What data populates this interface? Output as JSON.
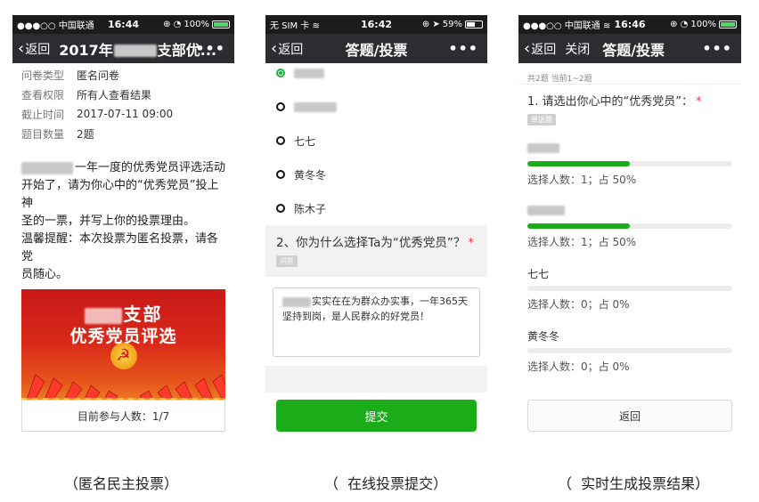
{
  "panel1": {
    "status": {
      "carrier": "●●●○○ 中国联通",
      "time": "16:44",
      "battery": "100%",
      "battery_level": 1.0
    },
    "nav": {
      "back": "返回",
      "title": "2017年",
      "title_tail": "支部优...",
      "more": "•••"
    },
    "info": [
      {
        "label": "问卷类型",
        "value": "匿名问卷"
      },
      {
        "label": "查看权限",
        "value": "所有人查看结果"
      },
      {
        "label": "截止时间",
        "value": "2017-07-11 09:00"
      },
      {
        "label": "题目数量",
        "value": "2题"
      }
    ],
    "desc_lines": [
      "一年一度的优秀党员评选活动",
      "开始了，请为你心中的“优秀党员”投上神",
      "圣的一票，并写上你的投票理由。",
      "温馨提醒：本次投票为匿名投票，请各党",
      "员随心。"
    ],
    "banner": {
      "line1": "支部",
      "line2": "优秀党员评选",
      "emblem": "☭"
    },
    "count_button": "目前参与人数：1/7"
  },
  "panel2": {
    "status": {
      "carrier": "无 SIM 卡",
      "time": "16:42",
      "battery": "59%",
      "battery_level": 0.59
    },
    "nav": {
      "back": "返回",
      "title": "答题/投票",
      "more": "•••"
    },
    "options": [
      {
        "label": "",
        "selected": true,
        "blurred": true
      },
      {
        "label": "",
        "selected": false,
        "blurred": true
      },
      {
        "label": "七七",
        "selected": false,
        "blurred": false
      },
      {
        "label": "黄冬冬",
        "selected": false,
        "blurred": false
      },
      {
        "label": "陈木子",
        "selected": false,
        "blurred": false
      }
    ],
    "question2": {
      "title": "2、你为什么选择Ta为“优秀党员”？",
      "required": "*",
      "tag": "问答"
    },
    "answer_lines": [
      "实实在在为群众办实事，一年365天",
      "坚持到岗，是人民群众的好党员！"
    ],
    "submit": "提交"
  },
  "panel3": {
    "status": {
      "carrier": "●●●○○ 中国联通",
      "time": "16:46",
      "battery": "100%",
      "battery_level": 1.0
    },
    "nav": {
      "back": "返回",
      "close": "关闭",
      "title": "答题/投票",
      "more": "•••"
    },
    "summary": "共2题 当前1~2题",
    "question1": {
      "title": "1. 请选出你心中的“优秀党员”：",
      "required": "*",
      "tag": "单选题"
    },
    "results": [
      {
        "name": "",
        "blurred": true,
        "fraction": 0.5,
        "count_text": "选择人数：1；占 50%"
      },
      {
        "name": "",
        "blurred": true,
        "fraction": 0.5,
        "count_text": "选择人数：1；占 50%"
      },
      {
        "name": "七七",
        "blurred": false,
        "fraction": 0.0,
        "count_text": "选择人数：0；占 0%"
      },
      {
        "name": "黄冬冬",
        "blurred": false,
        "fraction": 0.0,
        "count_text": "选择人数：0；占 0%"
      }
    ],
    "back_button": "返回"
  },
  "captions": [
    "（匿名民主投票）",
    "（  在线投票提交）",
    "（  实时生成投票结果）"
  ],
  "colors": {
    "navbar": "#2d2d31",
    "status": "#1c1c1c",
    "accent_green": "#1aad19",
    "banner_red": "#c81818",
    "required_red": "#ee3333"
  }
}
